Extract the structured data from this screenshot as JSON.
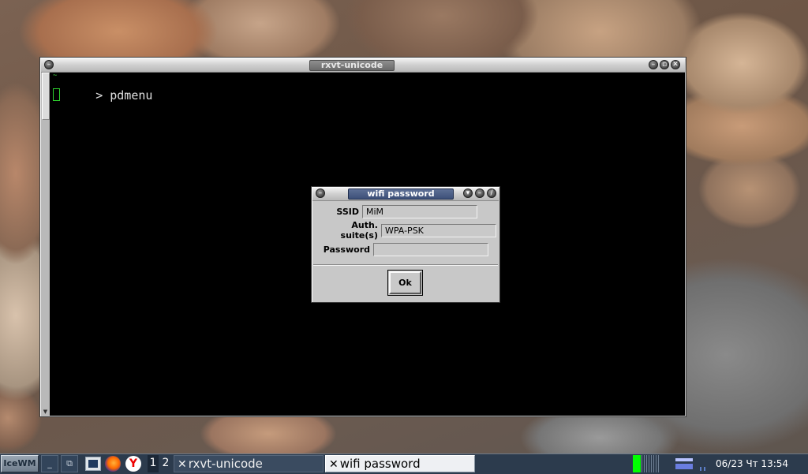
{
  "terminal": {
    "title": "rxvt-unicode",
    "prompt_symbol": "~",
    "prompt_arrow": ">",
    "command": "pdmenu"
  },
  "dialog": {
    "title": "wifi password",
    "ssid_label": "SSID",
    "ssid_value": "MiM",
    "auth_label": "Auth. suite(s)",
    "auth_value": "WPA-PSK",
    "password_label": "Password",
    "password_value": "",
    "ok_label": "Ok"
  },
  "taskbar": {
    "start_label": "IceWM",
    "workspaces": [
      "1",
      "2"
    ],
    "tasks": [
      {
        "label": "rxvt-unicode",
        "active": false
      },
      {
        "label": "wifi password",
        "active": true
      }
    ],
    "clock": "06/23 Чт 13:54"
  },
  "colors": {
    "terminal_bg": "#000000",
    "prompt_green": "#2ed12e",
    "taskbar_bg": "#2c3b4d",
    "dialog_title_bg": "#3d5079",
    "cpu_meter_green": "#00ff00"
  }
}
